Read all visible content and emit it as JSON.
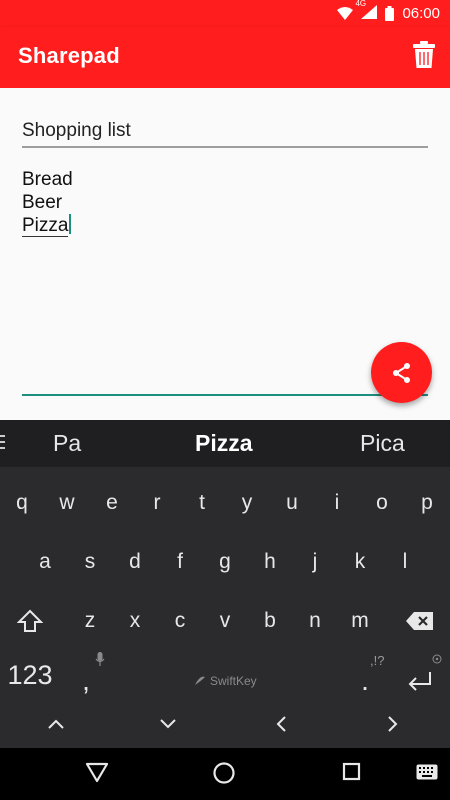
{
  "status_bar": {
    "network": "4G",
    "time": "06:00"
  },
  "app_bar": {
    "title": "Sharepad"
  },
  "note": {
    "title": "Shopping list",
    "lines": [
      "Bread",
      "Beer",
      "Pizza"
    ]
  },
  "keyboard": {
    "suggestions": [
      "Pa",
      "Pizza",
      "Pica"
    ],
    "row1": [
      "q",
      "w",
      "e",
      "r",
      "t",
      "y",
      "u",
      "i",
      "o",
      "p"
    ],
    "row2": [
      "a",
      "s",
      "d",
      "f",
      "g",
      "h",
      "j",
      "k",
      "l"
    ],
    "row3": [
      "z",
      "x",
      "c",
      "v",
      "b",
      "n",
      "m"
    ],
    "numbers_key": "123",
    "comma_key": ",",
    "period_key": ".",
    "punct_hint": ",!?",
    "brand": "SwiftKey"
  },
  "colors": {
    "accent": "#ff1d1d",
    "text_accent": "#1f8f7d",
    "keyboard_bg": "#2b2b2d"
  },
  "icons": [
    "signal-icon",
    "battery-icon",
    "trash-icon",
    "share-icon",
    "shift-icon",
    "backspace-icon",
    "mic-icon",
    "enter-icon",
    "arrow-up-icon",
    "arrow-down-icon",
    "arrow-left-icon",
    "arrow-right-icon",
    "back-icon",
    "home-icon",
    "recents-icon",
    "keyboard-icon"
  ]
}
